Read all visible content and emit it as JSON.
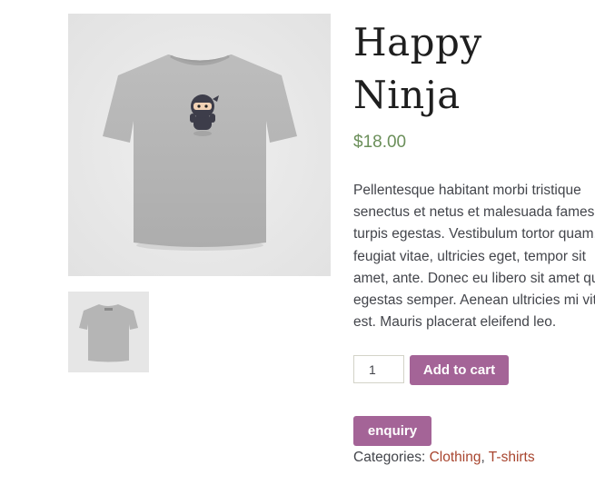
{
  "product": {
    "title_line1": "Happy",
    "title_line2": "Ninja",
    "price": "$18.00",
    "description_lines": [
      "Pellentesque habitant morbi tristique",
      "senectus et netus et malesuada fames ac",
      "turpis egestas. Vestibulum tortor quam,",
      "feugiat vitae, ultricies eget, tempor sit",
      "amet, ante. Donec eu libero sit amet quam",
      "egestas semper. Aenean ultricies mi vitae",
      "est. Mauris placerat eleifend leo."
    ],
    "quantity": "1",
    "add_to_cart_label": "Add to cart",
    "enquiry_label": "enquiry",
    "categories_label": "Categories:",
    "categories": [
      "Clothing",
      "T-shirts"
    ],
    "category_separator": ", "
  },
  "images": {
    "main_icon": "tshirt-ninja-front-image",
    "thumb_icon": "tshirt-back-image"
  },
  "colors": {
    "accent": "#a46497",
    "price": "#6b8f5a",
    "link": "#a8452f",
    "image_bg": "#e6e6e6"
  }
}
